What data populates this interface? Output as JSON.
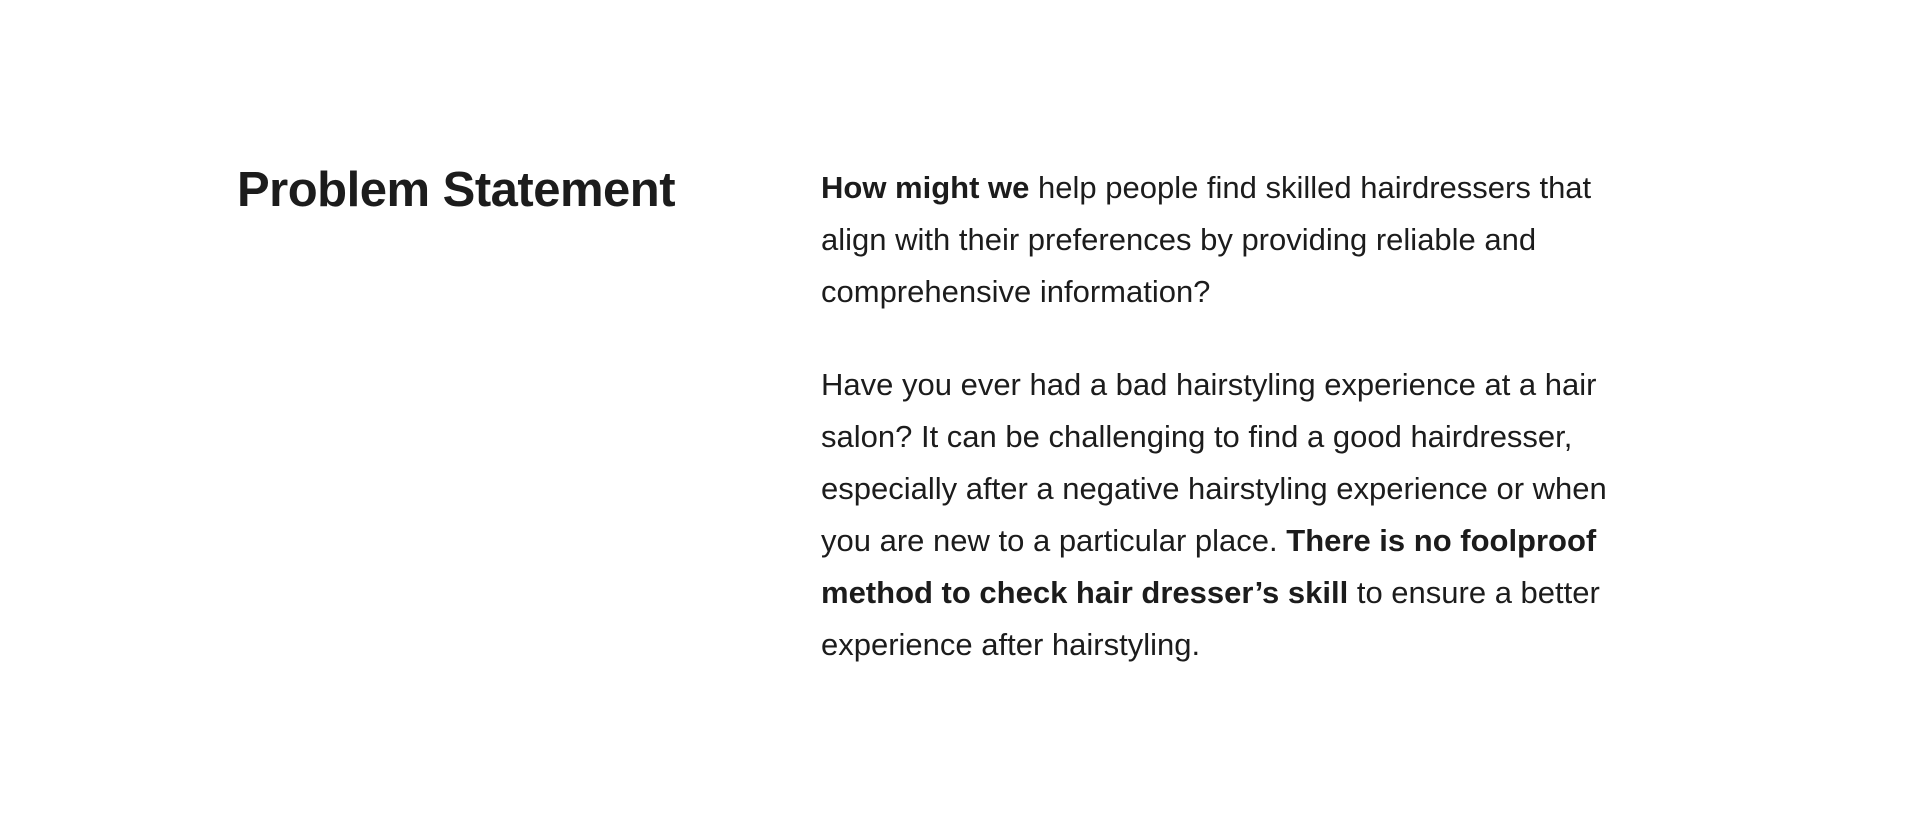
{
  "section": {
    "title": "Problem Statement",
    "paragraphs": [
      {
        "lead_bold": "How might we",
        "text": " help people find skilled hairdressers that align with their preferences by providing reliable and comprehensive information?"
      },
      {
        "text_before": "Have you ever had a bad hairstyling experience at a hair salon? It can be challenging to find a good hairdresser, especially after a negative hairstyling experience or when you are new to a particular place. ",
        "bold": "There is no foolproof method to check hair dresser’s skill",
        "text_after": " to ensure a better experience after hairstyling."
      }
    ]
  },
  "colors": {
    "background": "#ffffff",
    "text": "#1c1c1c"
  }
}
